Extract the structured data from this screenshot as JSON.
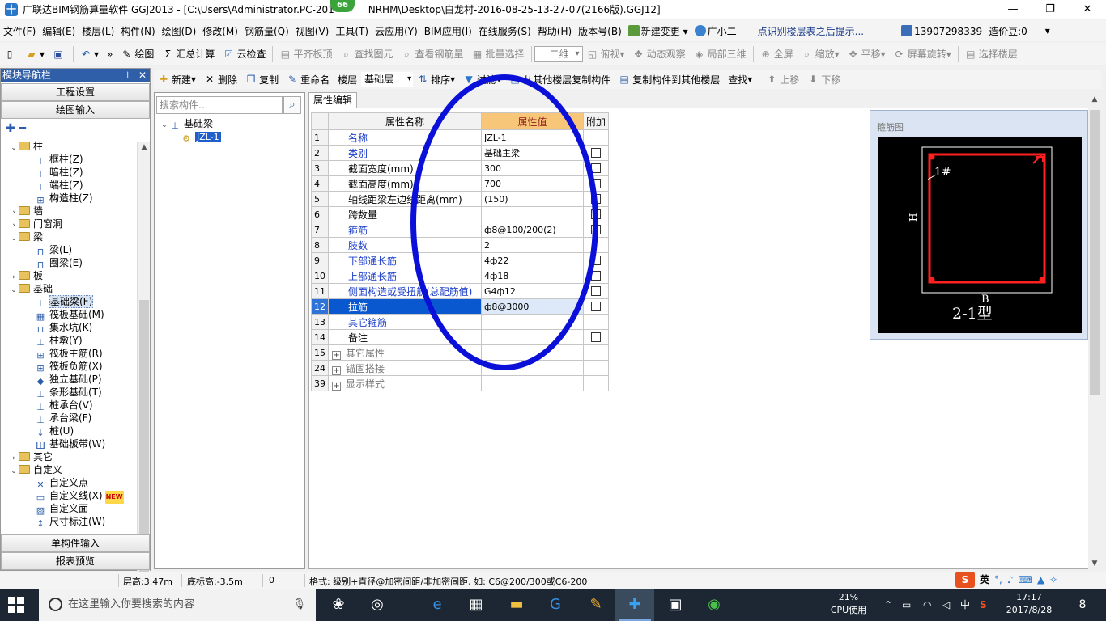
{
  "window": {
    "title": "广联达BIM钢筋算量软件 GGJ2013 - [C:\\Users\\Administrator.PC-201",
    "title_tail": "NRHM\\Desktop\\白龙村-2016-08-25-13-27-07(2166版).GGJ12]",
    "badge": "66"
  },
  "menu": {
    "items": [
      "文件(F)",
      "编辑(E)",
      "楼层(L)",
      "构件(N)",
      "绘图(D)",
      "修改(M)",
      "钢筋量(Q)",
      "视图(V)",
      "工具(T)",
      "云应用(Y)",
      "BIM应用(I)",
      "在线服务(S)",
      "帮助(H)",
      "版本号(B)"
    ],
    "new_change": "新建变更",
    "assistant": "广小二",
    "hint": "点识别楼层表之后提示...",
    "phone": "13907298339",
    "beans": "造价豆:0"
  },
  "toolbar1": {
    "draw": "绘图",
    "sum": "汇总计算",
    "cloud_check": "云检查",
    "flat_top": "平齐板顶",
    "find_elem": "查找图元",
    "view_rebar": "查看钢筋量",
    "batch_select": "批量选择",
    "view_2d": "二维",
    "top_view": "俯视",
    "dynamic": "动态观察",
    "local_3d": "局部三维",
    "fullscreen": "全屏",
    "zoom": "缩放",
    "pan": "平移",
    "rotate": "屏幕旋转",
    "select_floor": "选择楼层"
  },
  "nav": {
    "title": "模块导航栏",
    "project_settings": "工程设置",
    "draw_input": "绘图输入",
    "single_input": "单构件输入",
    "report_preview": "报表预览",
    "tree": [
      {
        "level": 0,
        "toggle": "⌄",
        "folder": true,
        "label": "柱"
      },
      {
        "level": 1,
        "icon": "T",
        "label": "框柱(Z)"
      },
      {
        "level": 1,
        "icon": "T",
        "label": "暗柱(Z)"
      },
      {
        "level": 1,
        "icon": "T",
        "label": "端柱(Z)"
      },
      {
        "level": 1,
        "icon": "⊞",
        "label": "构造柱(Z)"
      },
      {
        "level": 0,
        "toggle": "›",
        "folder": true,
        "label": "墙"
      },
      {
        "level": 0,
        "toggle": "›",
        "folder": true,
        "label": "门窗洞"
      },
      {
        "level": 0,
        "toggle": "⌄",
        "folder": true,
        "label": "梁"
      },
      {
        "level": 1,
        "icon": "⊓",
        "label": "梁(L)"
      },
      {
        "level": 1,
        "icon": "⊓",
        "label": "圈梁(E)"
      },
      {
        "level": 0,
        "toggle": "›",
        "folder": true,
        "label": "板"
      },
      {
        "level": 0,
        "toggle": "⌄",
        "folder": true,
        "label": "基础"
      },
      {
        "level": 1,
        "icon": "⊥",
        "label": "基础梁(F)",
        "selected": true
      },
      {
        "level": 1,
        "icon": "▦",
        "label": "筏板基础(M)"
      },
      {
        "level": 1,
        "icon": "⊔",
        "label": "集水坑(K)"
      },
      {
        "level": 1,
        "icon": "⊥",
        "label": "柱墩(Y)"
      },
      {
        "level": 1,
        "icon": "⊞",
        "label": "筏板主筋(R)"
      },
      {
        "level": 1,
        "icon": "⊞",
        "label": "筏板负筋(X)"
      },
      {
        "level": 1,
        "icon": "◆",
        "label": "独立基础(P)"
      },
      {
        "level": 1,
        "icon": "⊥",
        "label": "条形基础(T)"
      },
      {
        "level": 1,
        "icon": "⊥",
        "label": "桩承台(V)"
      },
      {
        "level": 1,
        "icon": "⊥",
        "label": "承台梁(F)"
      },
      {
        "level": 1,
        "icon": "↓",
        "label": "桩(U)"
      },
      {
        "level": 1,
        "icon": "Ш",
        "label": "基础板带(W)"
      },
      {
        "level": 0,
        "toggle": "›",
        "folder": true,
        "label": "其它"
      },
      {
        "level": 0,
        "toggle": "⌄",
        "folder": true,
        "label": "自定义"
      },
      {
        "level": 1,
        "icon": "✕",
        "label": "自定义点"
      },
      {
        "level": 1,
        "icon": "▭",
        "label": "自定义线(X)",
        "new": "NEW"
      },
      {
        "level": 1,
        "icon": "▨",
        "label": "自定义面"
      },
      {
        "level": 1,
        "icon": "↕",
        "label": "尺寸标注(W)"
      }
    ]
  },
  "listbar": {
    "new": "新建",
    "delete": "删除",
    "copy": "复制",
    "rename": "重命名",
    "floor_label": "楼层",
    "floor_value": "基础层",
    "sort": "排序",
    "filter": "过滤",
    "copy_from": "从其他楼层复制构件",
    "copy_to": "复制构件到其他楼层",
    "find": "查找",
    "move_up": "上移",
    "move_down": "下移"
  },
  "component_panel": {
    "search_placeholder": "搜索构件...",
    "root": "基础梁",
    "child": "JZL-1"
  },
  "properties": {
    "tab": "属性编辑",
    "headers": {
      "name": "属性名称",
      "value": "属性值",
      "extra": "附加"
    },
    "rows": [
      {
        "num": "1",
        "name": "名称",
        "value": "JZL-1",
        "checkbox": false
      },
      {
        "num": "2",
        "name": "类别",
        "value": "基础主梁",
        "checkbox": true
      },
      {
        "num": "3",
        "name": "截面宽度(mm)",
        "value": "300",
        "checkbox": true,
        "black": true
      },
      {
        "num": "4",
        "name": "截面高度(mm)",
        "value": "700",
        "checkbox": true,
        "black": true
      },
      {
        "num": "5",
        "name": "轴线距梁左边线距离(mm)",
        "value": "(150)",
        "checkbox": true,
        "black": true
      },
      {
        "num": "6",
        "name": "跨数量",
        "value": "",
        "checkbox": true,
        "black": true
      },
      {
        "num": "7",
        "name": "箍筋",
        "value": "ф8@100/200(2)",
        "checkbox": true
      },
      {
        "num": "8",
        "name": "肢数",
        "value": "2",
        "checkbox": false
      },
      {
        "num": "9",
        "name": "下部通长筋",
        "value": "4ф22",
        "checkbox": true
      },
      {
        "num": "10",
        "name": "上部通长筋",
        "value": "4ф18",
        "checkbox": true
      },
      {
        "num": "11",
        "name": "侧面构造或受扭筋(总配筋值)",
        "value": "G4ф12",
        "checkbox": true
      },
      {
        "num": "12",
        "name": "拉筋",
        "value": "ф8@3000",
        "checkbox": true,
        "selected": true
      },
      {
        "num": "13",
        "name": "其它箍筋",
        "value": "",
        "checkbox": false
      },
      {
        "num": "14",
        "name": "备注",
        "value": "",
        "checkbox": true,
        "black": true
      },
      {
        "num": "15",
        "name": "其它属性",
        "value": "",
        "checkbox": false,
        "group": true
      },
      {
        "num": "24",
        "name": "锚固搭接",
        "value": "",
        "checkbox": false,
        "group": true
      },
      {
        "num": "39",
        "name": "显示样式",
        "value": "",
        "checkbox": false,
        "group": true
      }
    ]
  },
  "rebar_diagram": {
    "caption": "箍筋图",
    "label_1": "1#",
    "label_h": "H",
    "label_b": "B",
    "type": "2-1型",
    "colors": {
      "outline": "#ffffff",
      "stirrup": "#ff2020",
      "bg": "#000000"
    }
  },
  "status": {
    "floor_height": "层高:3.47m",
    "base_height": "底标高:-3.5m",
    "zero": "0",
    "format": "格式: 级别+直径@加密间距/非加密间距, 如: C6@200/300或C6-200"
  },
  "ime": {
    "lang": "英"
  },
  "taskbar": {
    "search_placeholder": "在这里输入你要搜索的内容",
    "cpu_percent": "21%",
    "cpu_label": "CPU使用",
    "ime_zh": "中",
    "time": "17:17",
    "date": "2017/8/28",
    "notifications": "8"
  },
  "annotation_color": "#0a10d8"
}
